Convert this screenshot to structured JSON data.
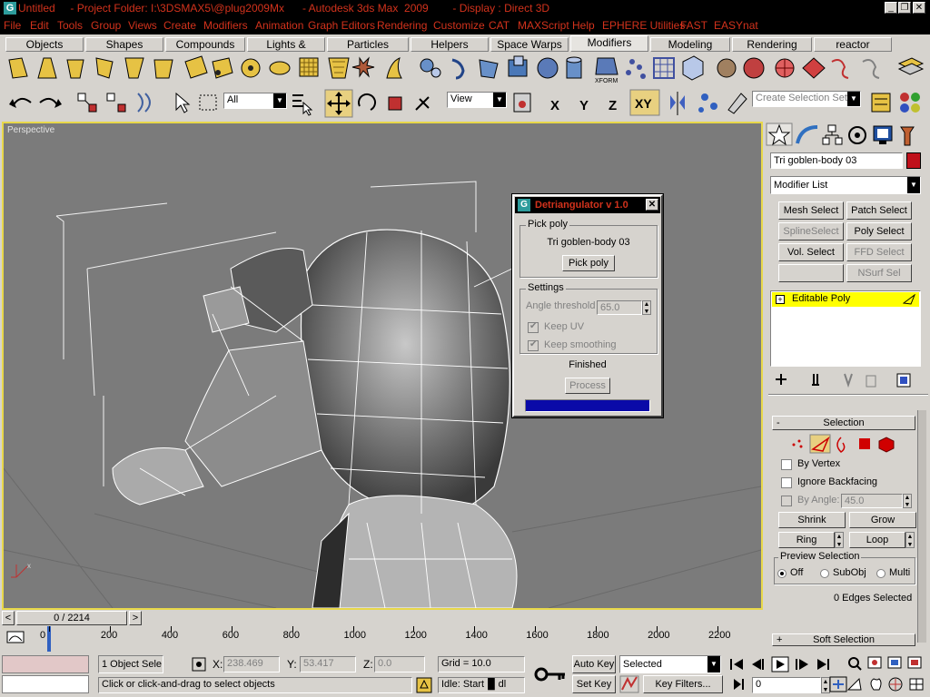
{
  "titlebar": {
    "text": "Untitled     - Project Folder: I:\\3DSMAX5\\@plug2009Mx      - Autodesk 3ds Max  2009        - Display : Direct 3D",
    "icon_letter": "G"
  },
  "menu": [
    "File",
    "Edit",
    "Tools",
    "Group",
    "Views",
    "Create",
    "Modifiers",
    "Animation",
    "Graph Editors",
    "Rendering",
    "Customize",
    "CAT",
    "MAXScript",
    "Help",
    "EPHERE Utilities",
    "FAST",
    "EASYnat"
  ],
  "tabs": [
    "Objects",
    "Shapes",
    "Compounds",
    "Lights & Cameras",
    "Particles",
    "Helpers",
    "Space Warps",
    "Modifiers",
    "Modeling",
    "Rendering",
    "reactor"
  ],
  "active_tab": "Modifiers",
  "toolbar": {
    "filter_value": "All",
    "refcoord_value": "View",
    "axis_x": "X",
    "axis_y": "Y",
    "axis_z": "Z",
    "axis_xy": "XY",
    "xform_label": "XFORM",
    "selection_set_placeholder": "Create Selection Set"
  },
  "viewport": {
    "label": "Perspective"
  },
  "dialog": {
    "title": "Detriangulator v 1.0",
    "pickpoly_group": "Pick poly",
    "object_name": "Tri goblen-body 03",
    "pick_button": "Pick poly",
    "settings_group": "Settings",
    "angle_label": "Angle threshold",
    "angle_value": "65.0",
    "keep_uv_label": "Keep UV",
    "keep_smoothing_label": "Keep smoothing",
    "status_text": "Finished",
    "process_button": "Process",
    "progress": 1.0
  },
  "command_panel": {
    "object_name": "Tri goblen-body 03",
    "object_color": "#c0101a",
    "modifier_list": "Modifier List",
    "buttons": [
      "Mesh Select",
      "Patch Select",
      "SplineSelect",
      "Poly Select",
      "Vol. Select",
      "FFD Select",
      "",
      "NSurf Sel"
    ],
    "stack_item": "Editable Poly",
    "stack_highlight": "#ffff00",
    "selection_rollout": "Selection",
    "by_vertex": "By Vertex",
    "ignore_backfacing": "Ignore Backfacing",
    "by_angle": "By Angle:",
    "by_angle_value": "45.0",
    "shrink": "Shrink",
    "grow": "Grow",
    "ring": "Ring",
    "loop": "Loop",
    "preview_selection": "Preview Selection",
    "preview_options": [
      "Off",
      "SubObj",
      "Multi"
    ],
    "edges_selected": "0 Edges Selected",
    "soft_selection": "Soft Selection"
  },
  "timeline": {
    "frame_text": "0 / 2214",
    "prev": "<",
    "next": ">"
  },
  "trackbar": {
    "ticks": [
      "0",
      "200",
      "400",
      "600",
      "800",
      "1000",
      "1200",
      "1400",
      "1600",
      "1800",
      "2000",
      "2200"
    ]
  },
  "status": {
    "selected_text": "1 Object Sele",
    "x_label": "X:",
    "x_value": "238.469",
    "y_label": "Y:",
    "y_value": "53.417",
    "z_label": "Z:",
    "z_value": "0.0",
    "grid": "Grid = 10.0",
    "prompt": "Click or click-and-drag to select objects",
    "idle": "Idle: Start▐▌dl",
    "auto_key": "Auto Key",
    "set_key": "Set Key",
    "key_mode_value": "Selected",
    "key_filters": "Key Filters...",
    "frame_value": "0"
  }
}
